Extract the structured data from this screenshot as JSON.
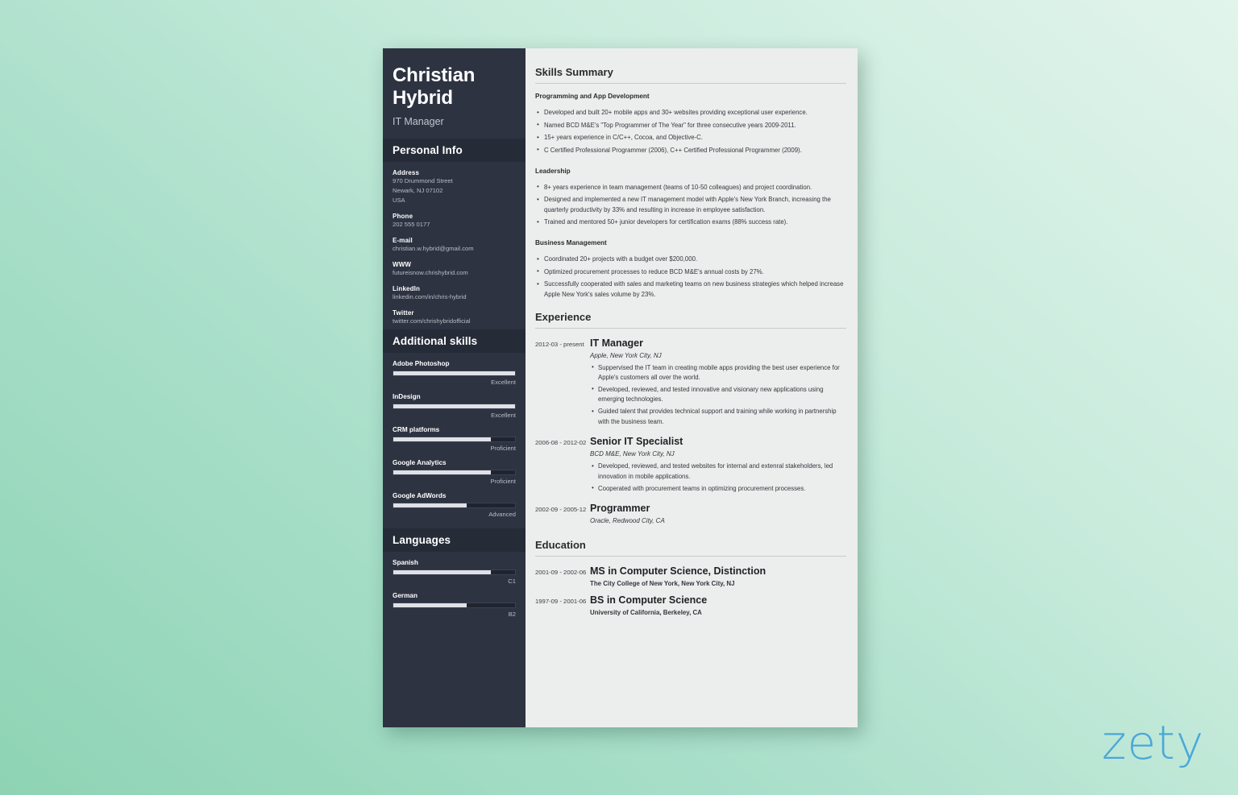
{
  "background": {
    "from_color": "#8ed3b4",
    "to_color": "#e2f4ec"
  },
  "watermark": {
    "text": "zety",
    "color": "#4aa8d8"
  },
  "sidebar": {
    "background_color": "#2e3342",
    "header_bar_color": "#262b38",
    "full_name": "Christian Hybrid",
    "job_title": "IT Manager",
    "personal_info_heading": "Personal Info",
    "personal_info": [
      {
        "label": "Address",
        "values": [
          "970 Drummond Street",
          "Newark, NJ 07102",
          "USA"
        ]
      },
      {
        "label": "Phone",
        "values": [
          "202 555 0177"
        ]
      },
      {
        "label": "E-mail",
        "values": [
          "christian.w.hybrid@gmail.com"
        ]
      },
      {
        "label": "WWW",
        "values": [
          "futureisnow.chrishybrid.com"
        ]
      },
      {
        "label": "LinkedIn",
        "values": [
          "linkedin.com/in/chris-hybrid"
        ]
      },
      {
        "label": "Twitter",
        "values": [
          "twitter.com/chrishybridofficial"
        ]
      }
    ],
    "additional_skills_heading": "Additional skills",
    "skills": [
      {
        "name": "Adobe Photoshop",
        "level": "Excellent",
        "percent": 100
      },
      {
        "name": "InDesign",
        "level": "Excellent",
        "percent": 100
      },
      {
        "name": "CRM platforms",
        "level": "Proficient",
        "percent": 80
      },
      {
        "name": "Google Analytics",
        "level": "Proficient",
        "percent": 80
      },
      {
        "name": "Google AdWords",
        "level": "Advanced",
        "percent": 60
      }
    ],
    "languages_heading": "Languages",
    "languages": [
      {
        "name": "Spanish",
        "level": "C1",
        "percent": 80
      },
      {
        "name": "German",
        "level": "B2",
        "percent": 60
      }
    ]
  },
  "main": {
    "skills_summary": {
      "heading": "Skills Summary",
      "groups": [
        {
          "title": "Programming and App Development",
          "bullets": [
            "Developed and built 20+ mobile apps and 30+ websites providing exceptional user experience.",
            "Named BCD M&E's \"Top Programmer of The Year\" for three consecutive years 2009-2011.",
            "15+ years experience in C/C++, Cocoa, and Objective-C.",
            "C Certified Professional Programmer (2006), C++ Certified Professional Programmer (2009)."
          ]
        },
        {
          "title": "Leadership",
          "bullets": [
            "8+ years experience in team management (teams of 10-50 colleagues) and project coordination.",
            "Designed and implemented a new IT management model with Apple's New York Branch, increasing the quarterly productivity by 33% and resulting in increase in employee satisfaction.",
            "Trained and mentored 50+ junior developers for certification exams (88% success rate)."
          ]
        },
        {
          "title": "Business Management",
          "bullets": [
            "Coordinated 20+ projects with a budget over $200,000.",
            "Optimized procurement processes to reduce BCD M&E's annual costs by 27%.",
            "Successfully cooperated with sales and marketing teams on new business strategies which helped increase Apple New York's sales volume by 23%."
          ]
        }
      ]
    },
    "experience": {
      "heading": "Experience",
      "entries": [
        {
          "dates": "2012-03 - present",
          "title": "IT Manager",
          "org": "Apple, New York City, NJ",
          "bullets": [
            "Suppervised the IT team in creating mobile apps providing the best user experience for Apple's customers all over the world.",
            "Developed, reviewed, and tested innovative and visionary new applications using emerging technologies.",
            "Guided talent that provides technical support and training while working in partnership with the business team."
          ]
        },
        {
          "dates": "2006-08 - 2012-02",
          "title": "Senior IT Specialist",
          "org": "BCD M&E, New York City, NJ",
          "bullets": [
            "Developed, reviewed, and tested websites for internal and extenral stakeholders, led innovation in mobile applications.",
            "Cooperated with procurement teams in optimizing procurement processes."
          ]
        },
        {
          "dates": "2002-09 - 2005-12",
          "title": "Programmer",
          "org": "Oracle, Redwood City, CA",
          "bullets": []
        }
      ]
    },
    "education": {
      "heading": "Education",
      "entries": [
        {
          "dates": "2001-09 - 2002-06",
          "title": "MS in Computer Science, Distinction",
          "org": "The City College of New York, New York City, NJ"
        },
        {
          "dates": "1997-09 - 2001-06",
          "title": "BS in Computer Science",
          "org": "University of California, Berkeley, CA"
        }
      ]
    }
  }
}
